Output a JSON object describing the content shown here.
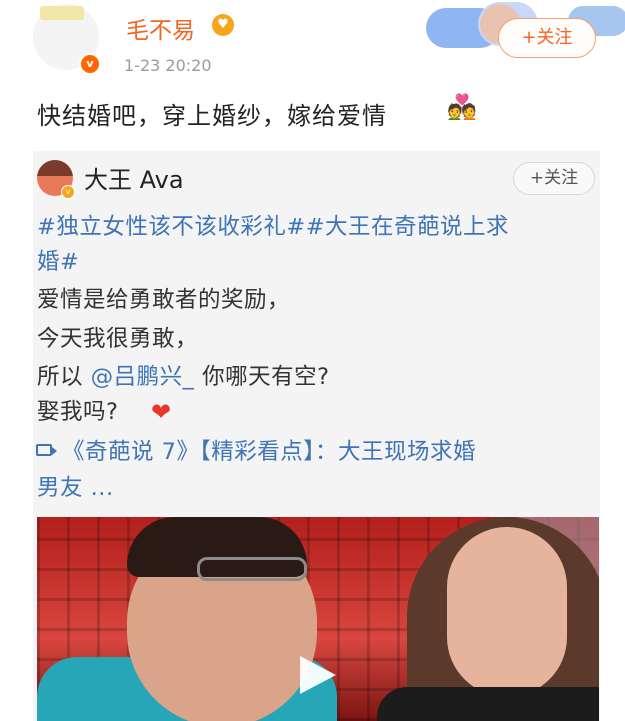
{
  "post": {
    "author": "毛不易",
    "time": "1-23 20:20",
    "follow_label": "+关注",
    "text": "快结婚吧，穿上婚纱，嫁给爱情",
    "emoji_icon": "wedding-couple-emoji"
  },
  "repost": {
    "author": "大王 Ava",
    "follow_label": "+关注",
    "tags_line1": "#独立女性该不该收彩礼##大王在奇葩说上求",
    "tags_line2": "婚#",
    "line3": "爱情是给勇敢者的奖励，",
    "line4": "今天我很勇敢，",
    "line5_prefix": "所以",
    "mention": "@吕鹏兴_",
    "line5_suffix": "你哪天有空?",
    "line6": "娶我吗?",
    "heart_icon": "red-heart-icon",
    "video_link_line1": "《奇葩说 7》【精彩看点】：大王现场求婚",
    "video_link_line2": "男友 ..."
  },
  "colors": {
    "accent_orange": "#f26522",
    "link_blue": "#3f74b6",
    "card_bg": "#f4f4f4"
  }
}
